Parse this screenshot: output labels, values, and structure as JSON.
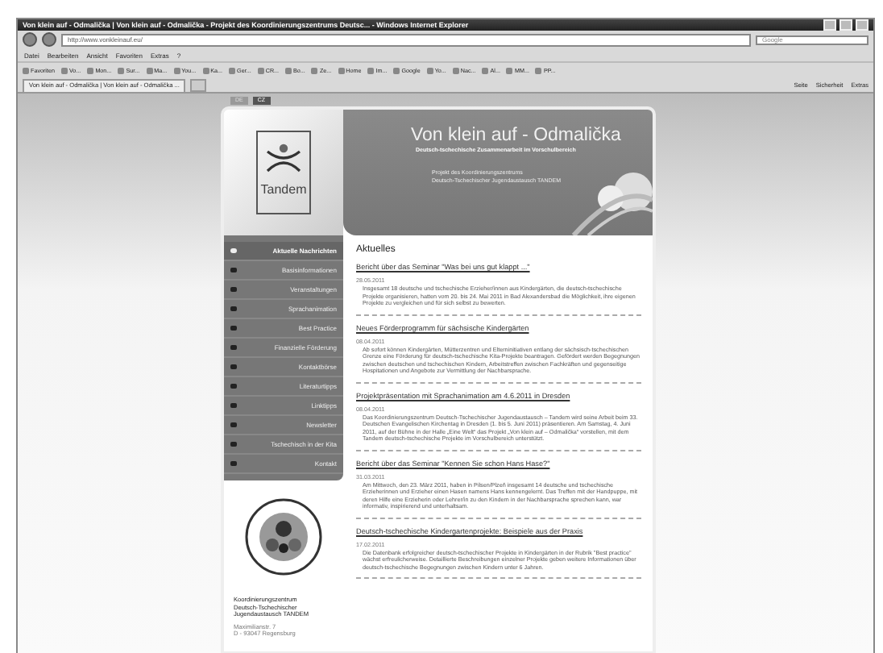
{
  "window": {
    "title": "Von klein auf - Odmalička | Von klein auf - Odmalička - Projekt des Koordinierungszentrums Deutsc... - Windows Internet Explorer"
  },
  "address_bar": {
    "value": "http://www.vonkleinauf.eu/",
    "search_placeholder": "Google"
  },
  "menu": [
    "Datei",
    "Bearbeiten",
    "Ansicht",
    "Favoriten",
    "Extras",
    "?"
  ],
  "favorites": [
    "Favoriten",
    "Vo...",
    "Mon...",
    "Sur...",
    "Ma...",
    "You...",
    "Ka...",
    "Ger...",
    "CR...",
    "Bo...",
    "Ze...",
    "Home",
    "Im...",
    "Google",
    "Yo...",
    "Nac...",
    "Al...",
    "MM...",
    "PP..."
  ],
  "tab": {
    "label": "Von klein auf - Odmalička | Von klein auf - Odmalička ..."
  },
  "command_bar": [
    "Seite",
    "Sicherheit",
    "Extras"
  ],
  "languages": [
    {
      "label": "DE",
      "selected": false
    },
    {
      "label": "CZ",
      "selected": true
    }
  ],
  "header": {
    "logo": "Tandem",
    "title": "Von klein auf - Odmalička",
    "subtitle": "Deutsch-tschechische Zusammenarbeit im Vorschulbereich",
    "project_lines": [
      "Projekt des Koordinierungszentrums",
      "Deutsch-Tschechischer Jugendaustausch TANDEM"
    ]
  },
  "sidebar": {
    "items": [
      {
        "label": "Aktuelle Nachrichten",
        "selected": true
      },
      {
        "label": "Basisinformationen",
        "selected": false
      },
      {
        "label": "Veranstaltungen",
        "selected": false
      },
      {
        "label": "Sprachanimation",
        "selected": false
      },
      {
        "label": "Best Practice",
        "selected": false
      },
      {
        "label": "Finanzielle Förderung",
        "selected": false
      },
      {
        "label": "Kontaktbörse",
        "selected": false
      },
      {
        "label": "Literaturtipps",
        "selected": false
      },
      {
        "label": "Linktipps",
        "selected": false
      },
      {
        "label": "Newsletter",
        "selected": false
      },
      {
        "label": "Tschechisch in der Kita",
        "selected": false
      },
      {
        "label": "Kontakt",
        "selected": false
      }
    ],
    "address_title": [
      "Koordinierungszentrum",
      "Deutsch-Tschechischer",
      "Jugendaustausch TANDEM"
    ],
    "address_lines": [
      "Maximilianstr. 7",
      "D - 93047 Regensburg"
    ]
  },
  "content": {
    "heading": "Aktuelles",
    "articles": [
      {
        "title": "Bericht über das Seminar \"Was bei uns gut klappt ...\"",
        "date": "28.05.2011",
        "text": "Insgesamt 18 deutsche und tschechische Erzieher/innen aus Kindergärten, die deutsch-tschechische Projekte organisieren, hatten vom 20. bis 24. Mai 2011 in Bad Alexandersbad die Möglichkeit, ihre eigenen Projekte zu vergleichen und für sich selbst zu bewerten."
      },
      {
        "title": "Neues Förderprogramm für sächsische Kindergärten",
        "date": "08.04.2011",
        "text": "Ab sofort können Kindergärten, Mütterzentren und Elterninitiativen entlang der sächsisch-tschechischen Grenze eine Förderung für deutsch-tschechische Kita-Projekte beantragen. Gefördert werden Begegnungen zwischen deutschen und tschechischen Kindern, Arbeitstreffen zwischen Fachkräften und gegenseitige Hospitationen und Angebote zur Vermittlung der Nachbarsprache."
      },
      {
        "title": "Projektpräsentation mit Sprachanimation am 4.6.2011 in Dresden",
        "date": "08.04.2011",
        "text": "Das Koordinierungszentrum Deutsch-Tschechischer Jugendaustausch – Tandem wird seine Arbeit beim 33. Deutschen Evangelischen Kirchentag in Dresden (1. bis 5. Juni 2011) präsentieren. Am Samstag, 4. Juni 2011, auf der Bühne in der Halle „Eine Welt“ das Projekt „Von klein auf – Odmalička“ vorstellen, mit dem Tandem deutsch-tschechische Projekte im Vorschulbereich unterstützt."
      },
      {
        "title": "Bericht über das Seminar \"Kennen Sie schon Hans Hase?\"",
        "date": "31.03.2011",
        "text": "Am Mittwoch, den 23. März 2011, haben in Pilsen/Plzeň insgesamt 14 deutsche und tschechische Erzieherinnen und Erzieher einen Hasen namens Hans kennengelernt. Das Treffen mit der Handpuppe, mit deren Hilfe eine Erzieherin oder Lehrer/in zu den Kindern in der Nachbarsprache sprechen kann, war informativ, inspirierend und unterhaltsam."
      },
      {
        "title": "Deutsch-tschechische Kindergartenprojekte: Beispiele aus der Praxis",
        "date": "17.02.2011",
        "text": "Die Datenbank erfolgreicher deutsch-tschechischer Projekte in Kindergärten in der Rubrik \"Best practice\" wächst erfreulicherweise. Detaillierte Beschreibungen einzelner Projekte geben weitere Informationen über deutsch-tschechische Begegnungen zwischen Kindern unter 6 Jahren."
      }
    ]
  }
}
